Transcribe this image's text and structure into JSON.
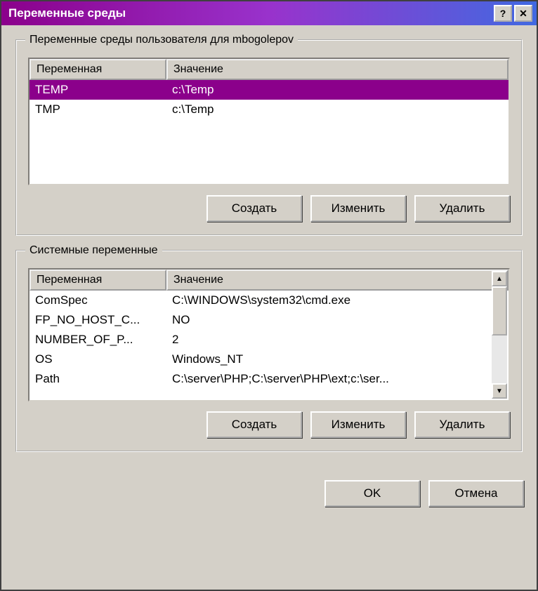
{
  "window": {
    "title": "Переменные среды"
  },
  "user_section": {
    "title": "Переменные среды пользователя для mbogolepov",
    "columns": {
      "var": "Переменная",
      "val": "Значение"
    },
    "rows": [
      {
        "var": "TEMP",
        "val": "c:\\Temp",
        "selected": true
      },
      {
        "var": "TMP",
        "val": "c:\\Temp",
        "selected": false
      }
    ],
    "buttons": {
      "create": "Создать",
      "edit": "Изменить",
      "delete": "Удалить"
    }
  },
  "system_section": {
    "title": "Системные переменные",
    "columns": {
      "var": "Переменная",
      "val": "Значение"
    },
    "rows": [
      {
        "var": "ComSpec",
        "val": "C:\\WINDOWS\\system32\\cmd.exe"
      },
      {
        "var": "FP_NO_HOST_C...",
        "val": "NO"
      },
      {
        "var": "NUMBER_OF_P...",
        "val": "2"
      },
      {
        "var": "OS",
        "val": "Windows_NT"
      },
      {
        "var": "Path",
        "val": "C:\\server\\PHP;C:\\server\\PHP\\ext;c:\\ser..."
      }
    ],
    "buttons": {
      "create": "Создать",
      "edit": "Изменить",
      "delete": "Удалить"
    }
  },
  "dialog_buttons": {
    "ok": "OK",
    "cancel": "Отмена"
  }
}
